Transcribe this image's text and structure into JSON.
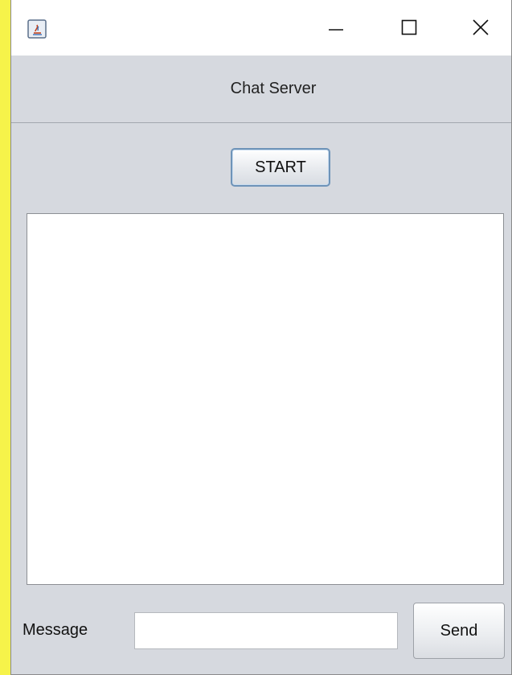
{
  "window": {
    "title": "",
    "controls": {
      "minimize": "minimize-icon",
      "maximize": "maximize-icon",
      "close": "close-icon"
    },
    "app_icon": "java-icon"
  },
  "header": {
    "title": "Chat Server"
  },
  "controls": {
    "start_label": "START"
  },
  "log": {
    "content": ""
  },
  "message_bar": {
    "label": "Message",
    "input_value": "",
    "send_label": "Send"
  },
  "colors": {
    "background": "#d6d9df",
    "titlebar": "#ffffff",
    "outer_border": "#f6f34a",
    "button_border_focus": "#6e93b8"
  }
}
